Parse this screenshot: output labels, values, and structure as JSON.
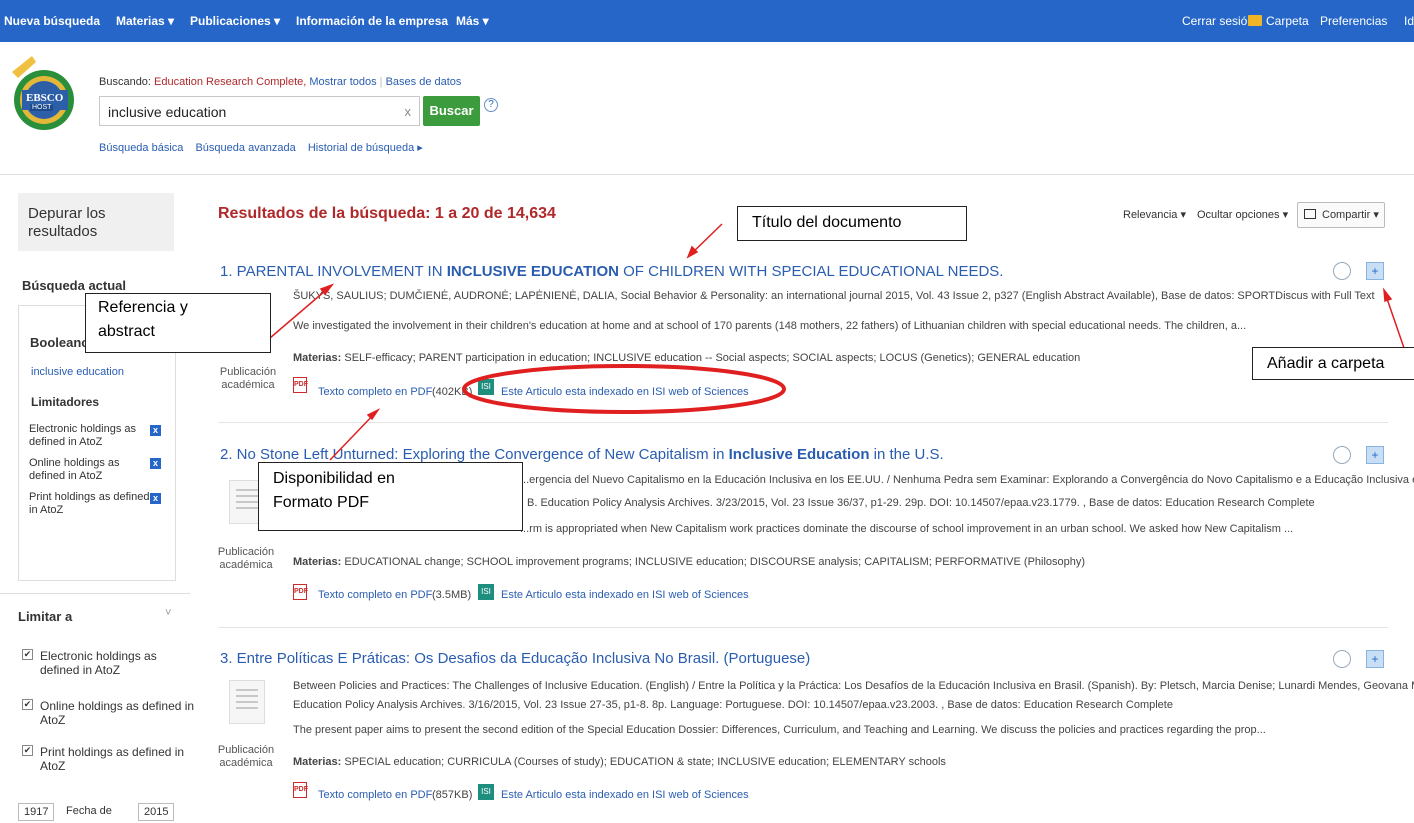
{
  "topnav": {
    "nueva": "Nueva búsqueda",
    "materias": "Materias ▾",
    "publicaciones": "Publicaciones ▾",
    "info": "Información de la empresa",
    "mas": "Más ▾",
    "cerrar": "Cerrar sesión",
    "carpeta": "Carpeta",
    "preferencias": "Preferencias",
    "cut": "Id"
  },
  "logo": {
    "line1": "EBSCO",
    "line2": "HOST"
  },
  "search": {
    "buscando_label": "Buscando:",
    "database": "Education Research Complete,",
    "mostrar": "Mostrar todos",
    "bases": "Bases de datos",
    "query": "inclusive education",
    "button": "Buscar",
    "basica": "Búsqueda básica",
    "avanzada": "Búsqueda avanzada",
    "historial": "Historial de búsqueda ▸"
  },
  "sidebar": {
    "depurar": "Depurar los resultados",
    "busqueda_actual": "Búsqueda actual",
    "booleano": "Booleano",
    "term": "inclusive education",
    "limitadores": "Limitadores",
    "lim1": "Electronic holdings as",
    "lim1b": "defined in AtoZ",
    "lim2": "Online holdings as",
    "lim2b": "defined in AtoZ",
    "lim3": "Print holdings as defined",
    "lim3b": "in AtoZ",
    "limitar": "Limitar a",
    "opt1": "Electronic holdings as",
    "opt1b": "defined in AtoZ",
    "opt2": "Online holdings as defined in",
    "opt2b": "AtoZ",
    "opt3": "Print holdings as defined in",
    "opt3b": "AtoZ",
    "year_from": "1917",
    "fecha": "Fecha de",
    "year_to": "2015"
  },
  "results": {
    "header": "Resultados de la búsqueda: 1 a 20 de 14,634",
    "relevancia": "Relevancia ▾",
    "ocultar": "Ocultar opciones ▾",
    "compartir": "Compartir ▾",
    "pdf_label": "Texto completo en PDF",
    "isi_label": "Este Articulo esta indexado en ISI web of Sciences",
    "pub_line1": "Publicación",
    "pub_line2": "académica",
    "materias": "Materias:",
    "items": [
      {
        "title_pre": "1. PARENTAL INVOLVEMENT IN ",
        "title_bold": "INCLUSIVE EDUCATION",
        "title_post": " OF CHILDREN WITH SPECIAL EDUCATIONAL NEEDS.",
        "meta": "ŠUKYS, SAULIUS; DUMČIENĖ, AUDRONĖ; LAPĖNIENĖ, DALIA, Social Behavior & Personality: an international journal 2015, Vol. 43 Issue 2, p327 (English Abstract Available), Base de datos: SPORTDiscus with Full Text",
        "abstract": "We investigated the involvement in their children's education at home and at school of 170 parents (148 mothers, 22 fathers) of Lithuanian children with special educational needs. The children, a...",
        "subjects": "SELF-efficacy; PARENT participation in education; INCLUSIVE education -- Social aspects; SOCIAL aspects; LOCUS (Genetics); GENERAL education",
        "size": "(402KB)"
      },
      {
        "title_pre": "2. No Stone Left Unturned: Exploring the Convergence of New Capitalism in ",
        "title_bold": "Inclusive Education",
        "title_post": " in the U.S.",
        "meta": "...ergencia del Nuevo Capitalismo en la Educación Inclusiva en los EE.UU. / Nenhuma Pedra sem Examinar: Explorando a Convergência do Novo Capitalismo e a Educação Inclusiva em os",
        "meta2": "B. Education Policy Analysis Archives. 3/23/2015, Vol. 23 Issue 36/37, p1-29. 29p. DOI: 10.14507/epaa.v23.1779. , Base de datos: Education Research Complete",
        "abstract": "...rm is appropriated when New Capitalism work practices dominate the discourse of school improvement in an urban school. We asked how New Capitalism ...",
        "subjects": "EDUCATIONAL change; SCHOOL improvement programs; INCLUSIVE education; DISCOURSE analysis; CAPITALISM; PERFORMATIVE (Philosophy)",
        "size": "(3.5MB)"
      },
      {
        "title_pre": "3. Entre Políticas E Práticas: Os Desafios da Educação Inclusiva No Brasil. (Portuguese)",
        "title_bold": "",
        "title_post": "",
        "meta": "Between Policies and Practices: The Challenges of Inclusive Education. (English) / Entre la Política y la Práctica: Los Desafíos de la Educación Inclusiva en Brasil. (Spanish). By: Pletsch, Marcia Denise; Lunardi Mendes, Geovana Mendonça.",
        "meta2": "Education Policy Analysis Archives. 3/16/2015, Vol. 23 Issue 27-35, p1-8. 8p. Language: Portuguese. DOI: 10.14507/epaa.v23.2003. , Base de datos: Education Research Complete",
        "abstract": "The present paper aims to present the second edition of the Special Education Dossier: Differences, Curriculum, and Teaching and Learning. We discuss the policies and practices regarding the prop...",
        "subjects": "SPECIAL education; CURRICULA (Courses of study); EDUCATION & state; INCLUSIVE education; ELEMENTARY schools",
        "size": "(857KB)"
      }
    ]
  },
  "callouts": {
    "titulo": "Título del documento",
    "referencia1": "Referencia y",
    "referencia2": "abstract",
    "anadir": "Añadir a carpeta",
    "pdf1": "Disponibilidad en",
    "pdf2": "Formato PDF"
  },
  "colors": {
    "nav": "#2566c8",
    "result_header": "#b0282a",
    "search_button": "#3c9b3c",
    "annotation_red": "#e02020"
  }
}
